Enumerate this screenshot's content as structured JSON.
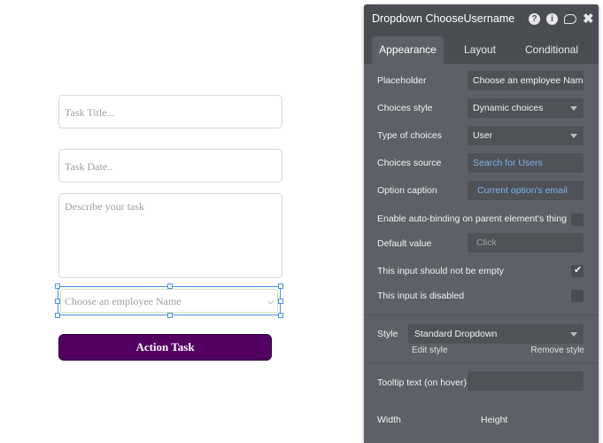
{
  "canvas": {
    "task_title_placeholder": "Task Title...",
    "task_date_placeholder": "Task Date..",
    "description_placeholder": "Describe your task",
    "dropdown_placeholder": "Choose an employee Name",
    "action_button_label": "Action Task",
    "action_button_color": "#530062"
  },
  "panel": {
    "title": "Dropdown ChooseUsername",
    "header_icons": [
      "help-icon",
      "info-icon",
      "comment-icon",
      "close-icon"
    ],
    "tabs": [
      {
        "label": "Appearance",
        "active": true
      },
      {
        "label": "Layout",
        "active": false
      },
      {
        "label": "Conditional",
        "active": false
      }
    ],
    "placeholder": {
      "label": "Placeholder",
      "value": "Choose an employee Name"
    },
    "choices_style": {
      "label": "Choices style",
      "value": "Dynamic choices"
    },
    "type_of_choices": {
      "label": "Type of choices",
      "value": "User"
    },
    "choices_source": {
      "label": "Choices source",
      "value": "Search for Users"
    },
    "option_caption": {
      "label": "Option caption",
      "value": "Current option's email"
    },
    "auto_binding": {
      "label": "Enable auto-binding on parent element's thing",
      "checked": false
    },
    "default_value": {
      "label": "Default value",
      "placeholder": "Click"
    },
    "not_empty": {
      "label": "This input should not be empty",
      "checked": true
    },
    "disabled": {
      "label": "This input is disabled",
      "checked": false
    },
    "style": {
      "label": "Style",
      "value": "Standard Dropdown",
      "edit_label": "Edit style",
      "remove_label": "Remove style"
    },
    "tooltip": {
      "label": "Tooltip text (on hover)",
      "value": ""
    },
    "width_label": "Width",
    "height_label": "Height"
  }
}
